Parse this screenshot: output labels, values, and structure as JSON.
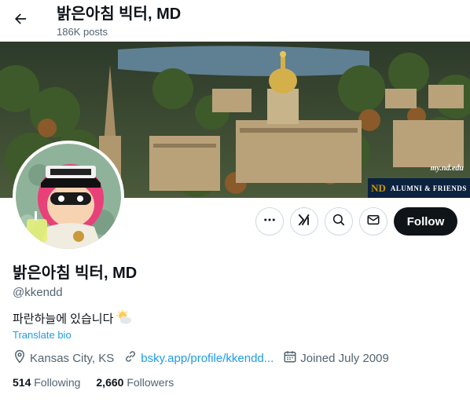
{
  "header": {
    "title": "밝은아침 빅터, MD",
    "posts_count": "186K posts"
  },
  "banner": {
    "url_text": "my.nd.edu",
    "badge_mark": "ND",
    "badge_text": "ALUMNI & FRIENDS"
  },
  "actions": {
    "follow_label": "Follow",
    "icons": [
      "more-icon",
      "grok-icon",
      "search-icon",
      "message-icon"
    ]
  },
  "profile": {
    "display_name": "밝은아침 빅터, MD",
    "handle": "@kkendd",
    "bio": "파란하늘에 있습니다",
    "translate_label": "Translate bio",
    "location": "Kansas City, KS",
    "website": "bsky.app/profile/kkendd...",
    "joined": "Joined July 2009",
    "following_count": "514",
    "following_label": "Following",
    "followers_count": "2,660",
    "followers_label": "Followers"
  },
  "colors": {
    "accent": "#1d9bf0",
    "text": "#0f1419",
    "secondary": "#536471",
    "border": "#cfd9de",
    "follow_bg": "#0f1419"
  }
}
